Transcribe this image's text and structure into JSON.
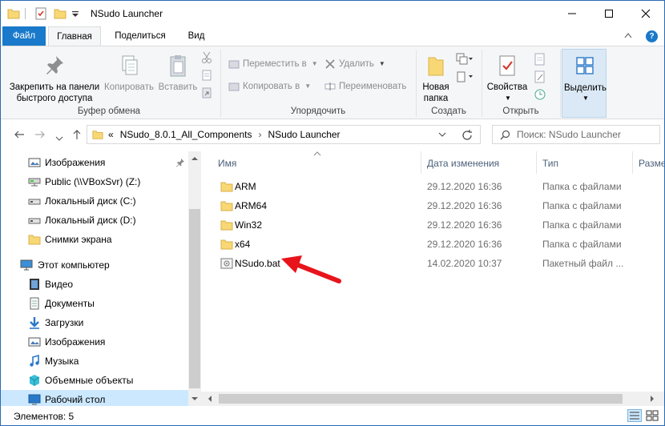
{
  "window": {
    "title": "NSudo Launcher",
    "minimize": "—",
    "maximize": "☐",
    "close": "✕"
  },
  "tabs": {
    "file": "Файл",
    "home": "Главная",
    "share": "Поделиться",
    "view": "Вид"
  },
  "ribbon": {
    "clipboard": {
      "pin": "Закрепить на панели быстрого доступа",
      "pin_l1": "Закрепить на панели",
      "pin_l2": "быстрого доступа",
      "copy": "Копировать",
      "paste": "Вставить",
      "group": "Буфер обмена"
    },
    "organize": {
      "move": "Переместить в",
      "copy_to": "Копировать в",
      "delete": "Удалить",
      "rename": "Переименовать",
      "group": "Упорядочить"
    },
    "new": {
      "new_folder_l1": "Новая",
      "new_folder_l2": "папка",
      "group": "Создать"
    },
    "open": {
      "properties": "Свойства",
      "group": "Открыть"
    },
    "select": {
      "label": "Выделить"
    }
  },
  "address": {
    "prefix": "«",
    "crumbs": [
      "NSudo_8.0.1_All_Components",
      "NSudo Launcher"
    ],
    "search_placeholder": "Поиск: NSudo Launcher"
  },
  "nav": {
    "items": [
      {
        "label": "Изображения",
        "icon": "pictures-icon"
      },
      {
        "label": "Public (\\\\VBoxSvr) (Z:)",
        "icon": "network-drive-icon"
      },
      {
        "label": "Локальный диск (C:)",
        "icon": "drive-icon"
      },
      {
        "label": "Локальный диск (D:)",
        "icon": "drive-icon"
      },
      {
        "label": "Снимки экрана",
        "icon": "folder-icon"
      },
      {
        "label": "Этот компьютер",
        "icon": "computer-icon"
      },
      {
        "label": "Видео",
        "icon": "video-icon"
      },
      {
        "label": "Документы",
        "icon": "documents-icon"
      },
      {
        "label": "Загрузки",
        "icon": "downloads-icon"
      },
      {
        "label": "Изображения",
        "icon": "pictures-icon"
      },
      {
        "label": "Музыка",
        "icon": "music-icon"
      },
      {
        "label": "Объемные объекты",
        "icon": "3d-objects-icon"
      },
      {
        "label": "Рабочий стол",
        "icon": "desktop-icon"
      }
    ]
  },
  "list": {
    "columns": {
      "name": "Имя",
      "date": "Дата изменения",
      "type": "Тип",
      "size": "Разме"
    },
    "rows": [
      {
        "name": "ARM",
        "date": "29.12.2020 16:36",
        "type": "Папка с файлами"
      },
      {
        "name": "ARM64",
        "date": "29.12.2020 16:36",
        "type": "Папка с файлами"
      },
      {
        "name": "Win32",
        "date": "29.12.2020 16:36",
        "type": "Папка с файлами"
      },
      {
        "name": "x64",
        "date": "29.12.2020 16:36",
        "type": "Папка с файлами"
      },
      {
        "name": "NSudo.bat",
        "date": "14.02.2020 10:37",
        "type": "Пакетный файл ..."
      }
    ]
  },
  "status": {
    "count": "Элементов: 5"
  },
  "colors": {
    "accent": "#1979ca",
    "folder": "#f8d775",
    "selection": "#cce8ff",
    "arrow": "#e8141c"
  }
}
